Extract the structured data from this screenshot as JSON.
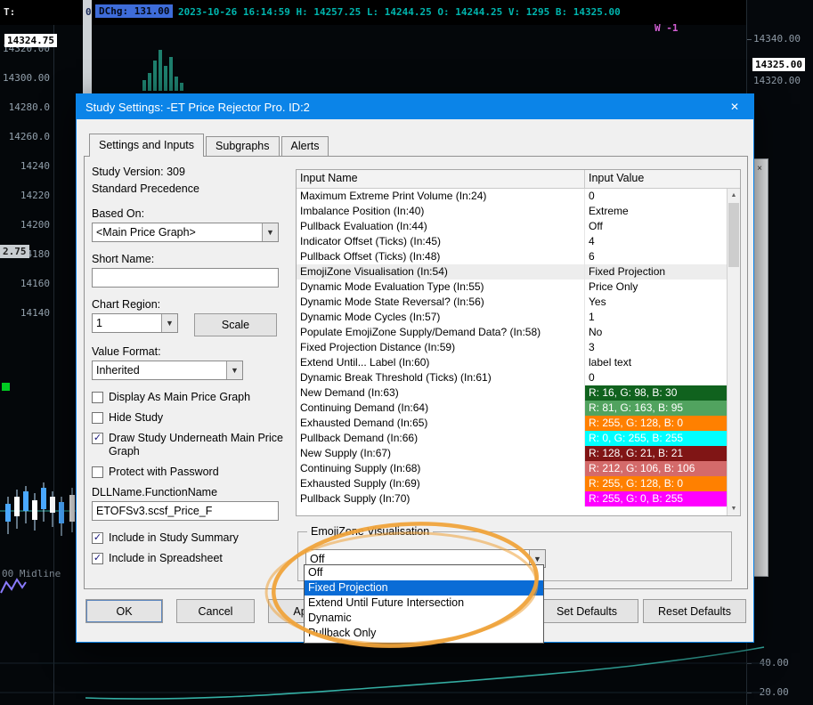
{
  "colors": {
    "accent": "#0b84e8",
    "selection": "#0a6cd6",
    "annotation": "#efa33b",
    "teal": "#00b5ae",
    "magenta": "#d45fd4"
  },
  "icons": {
    "close": "✕",
    "window_close": "×",
    "dropdown_arrow": "▼",
    "up_arrow": "▲",
    "down_arrow": "▼"
  },
  "chart": {
    "top_bar": {
      "t_label": "T:",
      "prefix_value": "0",
      "dchg_chip": "DChg: 131.00",
      "session_info": "2023-10-26 16:14:59 H: 14257.25 L: 14244.25 O: 14244.25 V: 1295 B: 14325.00",
      "w_label": "W -1"
    },
    "left_scale": {
      "last_price": "14324.75",
      "labels": [
        "14320.00",
        "14300.00",
        "14280.0",
        "14260.0",
        "14240",
        "14220",
        "14200",
        "14180",
        "14160",
        "14140"
      ],
      "extra_value": "2.75"
    },
    "right_scale": {
      "label_top": "14340.00",
      "last_price": "14325.00",
      "label_below": "14320.00",
      "labels_bottom": [
        "-40.00",
        "-20.00"
      ]
    },
    "midline_label": "00  Midline"
  },
  "dialog": {
    "title": "Study Settings: -ET Price Rejector Pro. ID:2",
    "tabs": [
      {
        "label": "Settings and Inputs",
        "cls": "selected"
      },
      {
        "label": "Subgraphs"
      },
      {
        "label": "Alerts"
      }
    ],
    "left_panel": {
      "study_version": "Study Version: 309",
      "precedence": "Standard Precedence",
      "based_on_label": "Based On:",
      "based_on_value": "<Main Price Graph>",
      "short_name_label": "Short Name:",
      "short_name_value": "",
      "chart_region_label": "Chart Region:",
      "chart_region_value": "1",
      "scale_button": "Scale",
      "value_format_label": "Value Format:",
      "value_format_value": "Inherited",
      "checkboxes_top": [
        {
          "label": "Display As Main Price Graph",
          "check": ""
        },
        {
          "label": "Hide Study",
          "check": ""
        },
        {
          "label": "Draw Study Underneath Main Price Graph",
          "check": "✓"
        },
        {
          "label": "Protect with Password",
          "check": ""
        }
      ],
      "dll_label": "DLLName.FunctionName",
      "dll_value": "ETOFSv3.scsf_Price_F",
      "checkboxes_bottom": [
        {
          "label": "Include in Study Summary",
          "check": "✓"
        },
        {
          "label": "Include in Spreadsheet",
          "check": "✓"
        }
      ]
    },
    "inputs_table": {
      "headers": [
        "Input Name",
        "Input Value"
      ],
      "rows": [
        {
          "name": "Maximum Extreme Print Volume  (In:24)",
          "value": "0"
        },
        {
          "name": "Imbalance Position  (In:40)",
          "value": "Extreme"
        },
        {
          "name": "Pullback Evaluation  (In:44)",
          "value": "Off"
        },
        {
          "name": "Indicator Offset (Ticks)  (In:45)",
          "value": "4"
        },
        {
          "name": "Pullback Offset (Ticks)  (In:48)",
          "value": "6"
        },
        {
          "name": "EmojiZone Visualisation  (In:54)",
          "value": "Fixed Projection",
          "rowbg": "#ededed"
        },
        {
          "name": "Dynamic Mode Evaluation Type  (In:55)",
          "value": "Price Only"
        },
        {
          "name": "Dynamic Mode State Reversal?  (In:56)",
          "value": "Yes"
        },
        {
          "name": "Dynamic Mode Cycles  (In:57)",
          "value": "1"
        },
        {
          "name": "Populate EmojiZone Supply/Demand Data?  (In:58)",
          "value": "No"
        },
        {
          "name": "Fixed Projection Distance  (In:59)",
          "value": "3"
        },
        {
          "name": "Extend Until... Label  (In:60)",
          "value": "label text"
        },
        {
          "name": "Dynamic Break Threshold (Ticks)  (In:61)",
          "value": "0"
        },
        {
          "name": "New Demand  (In:63)",
          "value": "R: 16, G: 98, B: 30",
          "bg": "#10621e",
          "fg": "#ffffff"
        },
        {
          "name": "Continuing Demand  (In:64)",
          "value": "R: 81, G: 163, B: 95",
          "bg": "#51a35f",
          "fg": "#ffffff"
        },
        {
          "name": "Exhausted Demand  (In:65)",
          "value": "R: 255, G: 128, B: 0",
          "bg": "#ff8000",
          "fg": "#ffffff"
        },
        {
          "name": "Pullback Demand  (In:66)",
          "value": "R: 0, G: 255, B: 255",
          "bg": "#00ffff",
          "fg": "#ffffff"
        },
        {
          "name": "New Supply  (In:67)",
          "value": "R: 128, G: 21, B: 21",
          "bg": "#801515",
          "fg": "#ffffff"
        },
        {
          "name": "Continuing Supply  (In:68)",
          "value": "R: 212, G: 106, B: 106",
          "bg": "#d46a6a",
          "fg": "#ffffff"
        },
        {
          "name": "Exhausted Supply  (In:69)",
          "value": "R: 255, G: 128, B: 0",
          "bg": "#ff8000",
          "fg": "#ffffff"
        },
        {
          "name": "Pullback Supply  (In:70)",
          "value": "R: 255, G: 0, B: 255",
          "bg": "#ff00ff",
          "fg": "#ffffff"
        }
      ]
    },
    "group_box": {
      "label": "EmojiZone Visualisation",
      "combo_value": "Off"
    },
    "dropdown": {
      "items": [
        {
          "label": "Off"
        },
        {
          "label": "Fixed Projection",
          "bg": "#0a6cd6",
          "fg": "#ffffff"
        },
        {
          "label": "Extend Until Future Intersection"
        },
        {
          "label": "Dynamic"
        },
        {
          "label": "Pullback Only"
        }
      ]
    },
    "buttons": {
      "ok": "OK",
      "cancel": "Cancel",
      "apply": "Apply",
      "set_defaults": "Set Defaults",
      "reset_defaults": "Reset Defaults"
    }
  }
}
